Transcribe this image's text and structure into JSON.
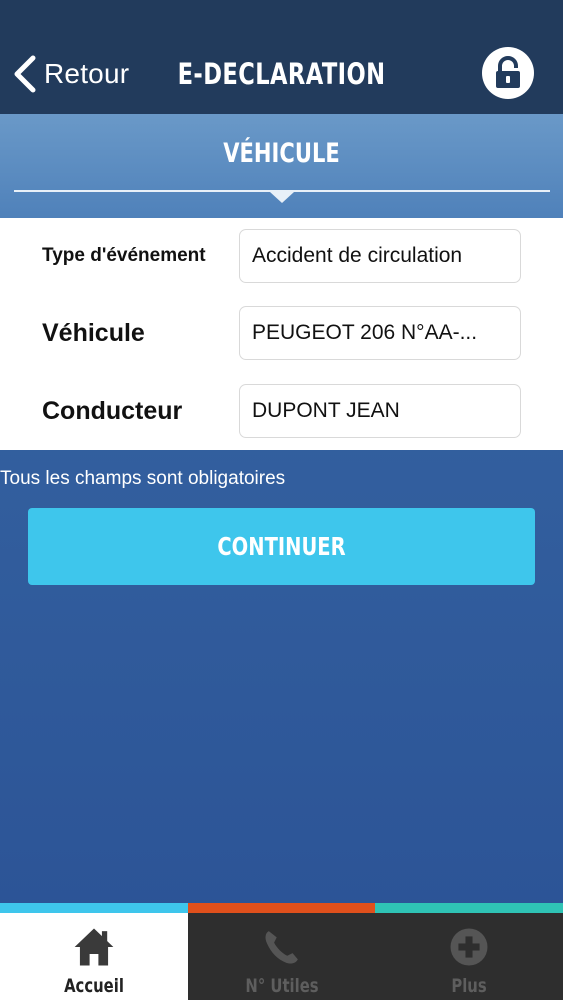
{
  "header": {
    "back_label": "Retour",
    "title": "E-DECLARATION",
    "lock_icon": "unlock-icon"
  },
  "section": {
    "title": "VÉHICULE"
  },
  "form": {
    "rows": [
      {
        "label": "Type d'événement",
        "value": "Accident de circulation"
      },
      {
        "label": "Véhicule",
        "value": "PEUGEOT 206 N°AA-..."
      },
      {
        "label": "Conducteur",
        "value": "DUPONT JEAN"
      }
    ],
    "required_note": "Tous les champs sont obligatoires",
    "continue_label": "CONTINUER"
  },
  "tabbar": {
    "accent_colors": [
      "#3ec6ec",
      "#e0501c",
      "#2fc3b5"
    ],
    "tabs": [
      {
        "label": "Accueil",
        "icon": "home-icon",
        "active": true
      },
      {
        "label": "N° Utiles",
        "icon": "phone-icon",
        "active": false
      },
      {
        "label": "Plus",
        "icon": "plus-circle-icon",
        "active": false
      }
    ]
  },
  "colors": {
    "header_bg": "#223b5c",
    "button": "#3ec6ec"
  }
}
